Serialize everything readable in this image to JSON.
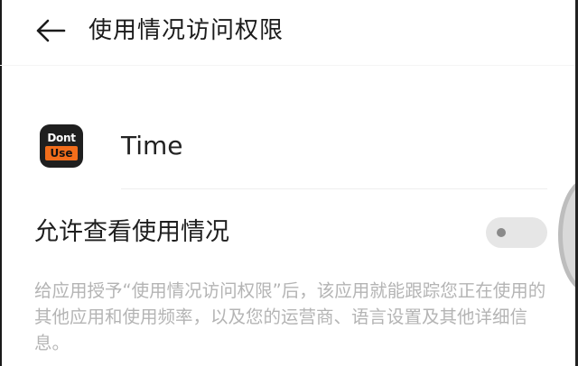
{
  "header": {
    "back_icon": "arrow-left-icon",
    "title": "使用情况访问权限"
  },
  "app": {
    "icon_name": "dont-use-app-icon",
    "icon_text_top": "Dont",
    "icon_text_bottom": "Use",
    "icon_colors": {
      "background": "#1f1f1f",
      "badge": "#f26d1b"
    },
    "name": "Time"
  },
  "permission": {
    "label": "允许查看使用情况",
    "enabled": false
  },
  "description": "给应用授予“使用情况访问权限”后，该应用就能跟踪您正在使用的其他应用和使用频率，以及您的运营商、语言设置及其他详细信息。",
  "colors": {
    "text_primary": "#1b1b1b",
    "text_secondary": "#b4b4b4",
    "toggle_off_track": "#e6e6e6",
    "toggle_off_knob": "#8a8a8a"
  }
}
